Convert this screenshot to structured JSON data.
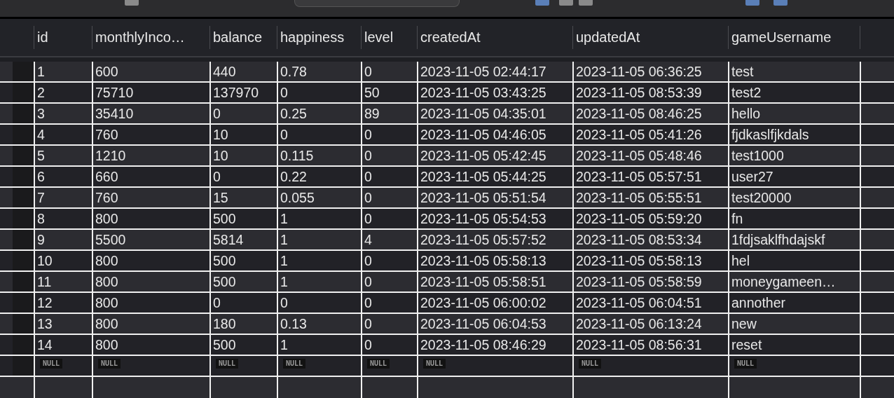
{
  "table": {
    "columns": [
      "id",
      "monthlyInco…",
      "balance",
      "happiness",
      "level",
      "createdAt",
      "updatedAt",
      "gameUsername"
    ],
    "rows": [
      [
        "1",
        "600",
        "440",
        "0.78",
        "0",
        "2023-11-05 02:44:17",
        "2023-11-05 06:36:25",
        "test"
      ],
      [
        "2",
        "75710",
        "137970",
        "0",
        "50",
        "2023-11-05 03:43:25",
        "2023-11-05 08:53:39",
        "test2"
      ],
      [
        "3",
        "35410",
        "0",
        "0.25",
        "89",
        "2023-11-05 04:35:01",
        "2023-11-05 08:46:25",
        "hello"
      ],
      [
        "4",
        "760",
        "10",
        "0",
        "0",
        "2023-11-05 04:46:05",
        "2023-11-05 05:41:26",
        "fjdkaslfjkdals"
      ],
      [
        "5",
        "1210",
        "10",
        "0.115",
        "0",
        "2023-11-05 05:42:45",
        "2023-11-05 05:48:46",
        "test1000"
      ],
      [
        "6",
        "660",
        "0",
        "0.22",
        "0",
        "2023-11-05 05:44:25",
        "2023-11-05 05:57:51",
        "user27"
      ],
      [
        "7",
        "760",
        "15",
        "0.055",
        "0",
        "2023-11-05 05:51:54",
        "2023-11-05 05:55:51",
        "test20000"
      ],
      [
        "8",
        "800",
        "500",
        "1",
        "0",
        "2023-11-05 05:54:53",
        "2023-11-05 05:59:20",
        "fn"
      ],
      [
        "9",
        "5500",
        "5814",
        "1",
        "4",
        "2023-11-05 05:57:52",
        "2023-11-05 08:53:34",
        "1fdjsaklfhdajskf"
      ],
      [
        "10",
        "800",
        "500",
        "1",
        "0",
        "2023-11-05 05:58:13",
        "2023-11-05 05:58:13",
        "hel"
      ],
      [
        "11",
        "800",
        "500",
        "1",
        "0",
        "2023-11-05 05:58:51",
        "2023-11-05 05:58:59",
        "moneygameen…"
      ],
      [
        "12",
        "800",
        "0",
        "0",
        "0",
        "2023-11-05 06:00:02",
        "2023-11-05 06:04:51",
        "annother"
      ],
      [
        "13",
        "800",
        "180",
        "0.13",
        "0",
        "2023-11-05 06:04:53",
        "2023-11-05 06:13:24",
        "new"
      ],
      [
        "14",
        "800",
        "500",
        "1",
        "0",
        "2023-11-05 08:46:29",
        "2023-11-05 08:56:31",
        "reset"
      ]
    ],
    "new_row": [
      "NULL",
      "NULL",
      "NULL",
      "NULL",
      "NULL",
      "NULL",
      "NULL",
      "NULL"
    ]
  }
}
